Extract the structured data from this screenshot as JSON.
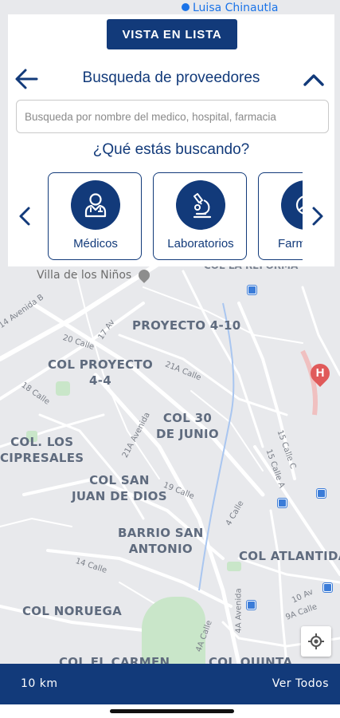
{
  "map": {
    "top_place": "Luisa Chinautla",
    "poi": "Villa de los Niños",
    "top_street": "COL LA REFORMA",
    "neighborhoods": {
      "proyecto_410": "PROYECTO 4-10",
      "col_proyecto_44": "COL PROYECTO\n4-4",
      "col_30_junio": "COL 30\nDE JUNIO",
      "col_los_cipresales": "COL. LOS\nCIPRESALES",
      "col_san_juan": "COL SAN\nJUAN DE DIOS",
      "barrio_san_antonio": "BARRIO SAN\nANTONIO",
      "col_atlantida": "COL ATLANTIDA",
      "col_noruega": "COL NORUEGA",
      "col_el_carmen": "COL EL CARMEN",
      "col_quinta": "COL QUINTA"
    },
    "streets": {
      "avenida_b": "14 Avenida B",
      "calle_20": "20 Calle",
      "av_17": "17 Av",
      "calle_21a": "21A Calle",
      "calle_18": "18 Calle",
      "avenida_21a": "21A Avenida",
      "calle_19": "19 Calle",
      "calle_4": "4 Calle",
      "calle_15c": "15 Calle C",
      "calle_15a": "15 Calle A",
      "calle_14": "14 Calle",
      "avenida_4a": "4A Avenida",
      "av_10": "10 Av",
      "calle_9a": "9A Calle",
      "calle_4a": "4A Calle"
    },
    "hospital_marker": "H"
  },
  "top_card": {
    "list_view_label": "VISTA EN LISTA",
    "title": "Busqueda de proveedores",
    "search_placeholder": "Busqueda por nombre del medico, hospital, farmacia",
    "question": "¿Qué estás buscando?",
    "categories": [
      {
        "label": "Médicos",
        "icon": "doctor-icon"
      },
      {
        "label": "Laboratorios",
        "icon": "microscope-icon"
      },
      {
        "label": "Farmacias",
        "icon": "pharmacy-icon"
      }
    ]
  },
  "bottom_bar": {
    "distance": "10 km",
    "see_all": "Ver Todos"
  },
  "colors": {
    "brand": "#123a7a",
    "map_bg": "#e8e9ec",
    "road": "#ffffff",
    "label": "#5f6b7e",
    "hospital": "#e05a5a"
  }
}
